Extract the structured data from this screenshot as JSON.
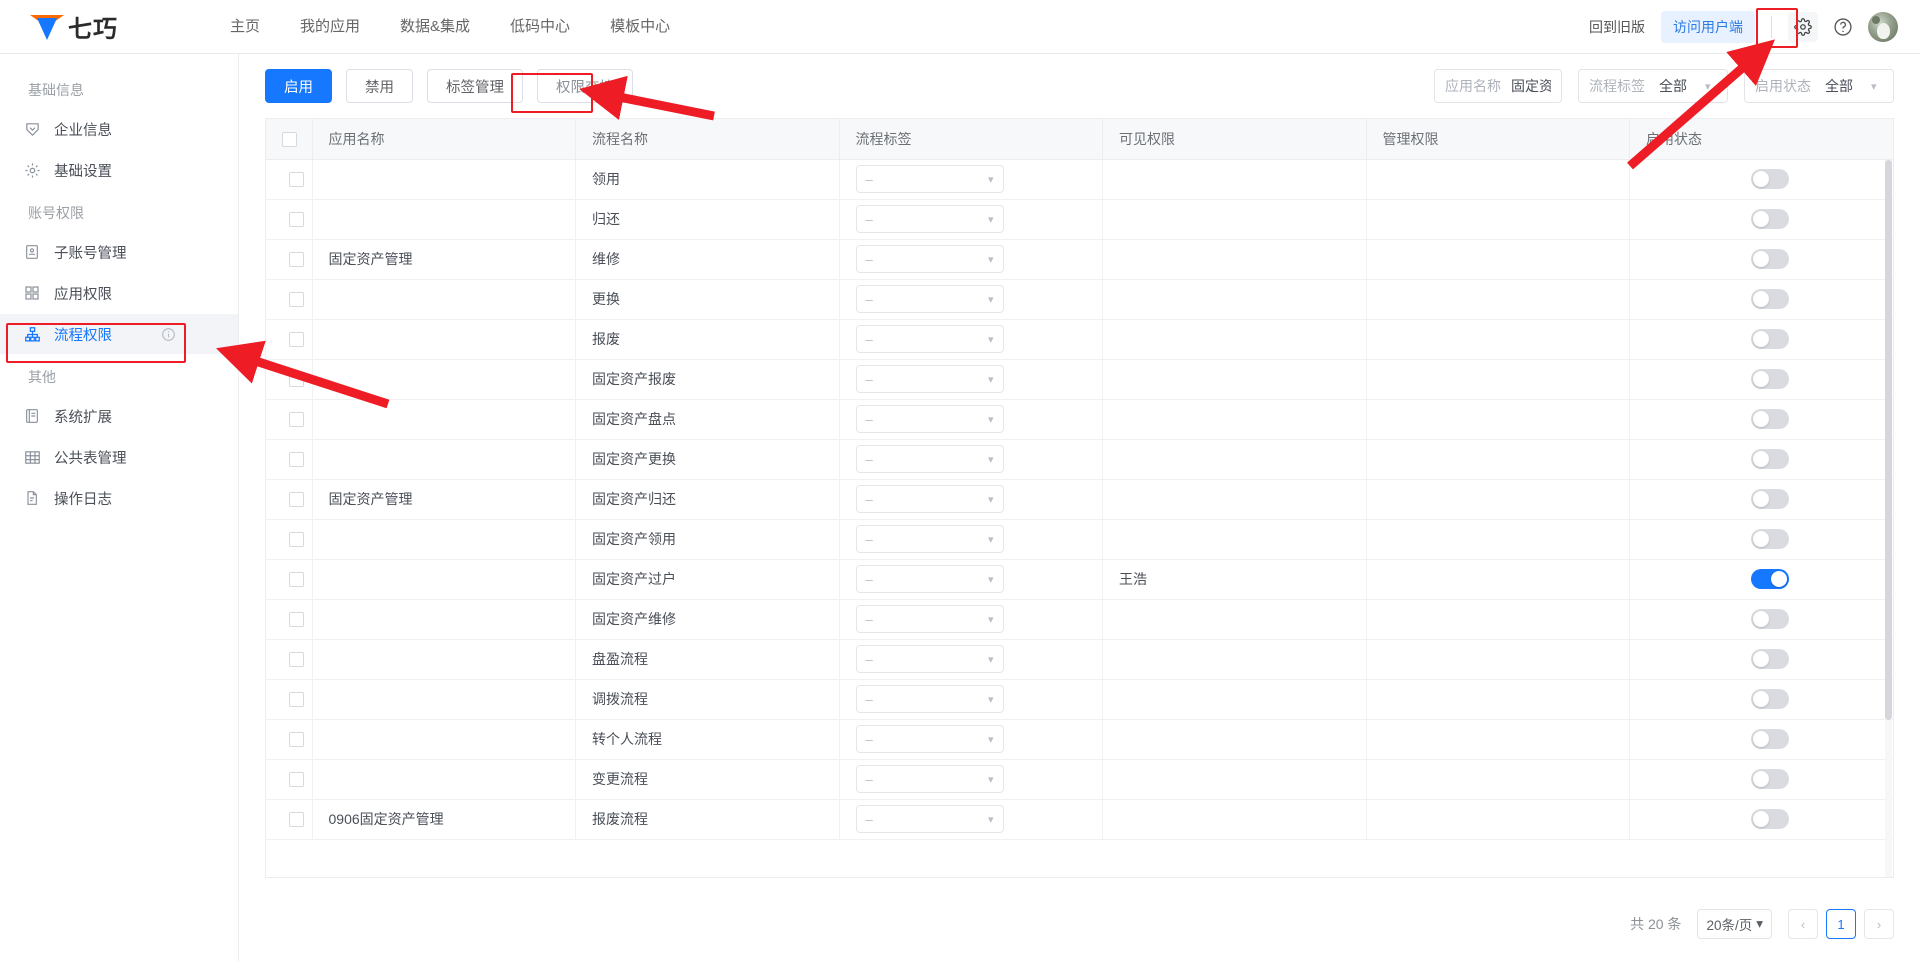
{
  "brand": {
    "name": "七巧",
    "logo_icon": "qiqiao-logo-icon"
  },
  "topnav": {
    "items": [
      {
        "label": "主页"
      },
      {
        "label": "我的应用"
      },
      {
        "label": "数据&集成"
      },
      {
        "label": "低码中心"
      },
      {
        "label": "模板中心"
      }
    ],
    "old_version_label": "回到旧版",
    "client_label": "访问用户端",
    "settings_icon": "gear-icon",
    "help_icon": "question-circle-icon",
    "avatar_icon": "user-avatar"
  },
  "sidebar": {
    "groups": [
      {
        "title": "基础信息",
        "items": [
          {
            "label": "企业信息",
            "icon": "shield-icon",
            "active": false
          },
          {
            "label": "基础设置",
            "icon": "gear-icon",
            "active": false
          }
        ]
      },
      {
        "title": "账号权限",
        "items": [
          {
            "label": "子账号管理",
            "icon": "id-card-icon",
            "active": false
          },
          {
            "label": "应用权限",
            "icon": "grid-apps-icon",
            "active": false
          },
          {
            "label": "流程权限",
            "icon": "sitemap-icon",
            "active": true,
            "info_icon": "info-circle-icon"
          }
        ]
      },
      {
        "title": "其他",
        "items": [
          {
            "label": "系统扩展",
            "icon": "book-icon",
            "active": false
          },
          {
            "label": "公共表管理",
            "icon": "table-icon",
            "active": false
          },
          {
            "label": "操作日志",
            "icon": "file-icon",
            "active": false
          }
        ]
      }
    ]
  },
  "toolbar": {
    "buttons": [
      {
        "label": "启用",
        "style": "primary"
      },
      {
        "label": "禁用",
        "style": "default"
      },
      {
        "label": "标签管理",
        "style": "default"
      },
      {
        "label": "权限交接",
        "style": "muted"
      }
    ],
    "filters": [
      {
        "label": "应用名称",
        "value": "固定资产管",
        "caret": false
      },
      {
        "label": "流程标签",
        "value": "全部",
        "caret": true
      },
      {
        "label": "启用状态",
        "value": "全部",
        "caret": true
      }
    ]
  },
  "table": {
    "columns": [
      "",
      "应用名称",
      "流程名称",
      "流程标签",
      "可见权限",
      "管理权限",
      "启用状态"
    ],
    "select_placeholder": "–",
    "rows": [
      {
        "app": "",
        "app_show": false,
        "flow": "领用",
        "tag": "–",
        "visible": "",
        "manage": "",
        "enabled": false
      },
      {
        "app": "",
        "app_show": false,
        "flow": "归还",
        "tag": "–",
        "visible": "",
        "manage": "",
        "enabled": false
      },
      {
        "app": "固定资产管理",
        "app_show": true,
        "flow": "维修",
        "tag": "–",
        "visible": "",
        "manage": "",
        "enabled": false
      },
      {
        "app": "",
        "app_show": false,
        "flow": "更换",
        "tag": "–",
        "visible": "",
        "manage": "",
        "enabled": false
      },
      {
        "app": "",
        "app_show": false,
        "flow": "报废",
        "tag": "–",
        "visible": "",
        "manage": "",
        "enabled": false,
        "group_end": true
      },
      {
        "app": "",
        "app_show": false,
        "flow": "固定资产报废",
        "tag": "–",
        "visible": "",
        "manage": "",
        "enabled": false
      },
      {
        "app": "",
        "app_show": false,
        "flow": "固定资产盘点",
        "tag": "–",
        "visible": "",
        "manage": "",
        "enabled": false
      },
      {
        "app": "",
        "app_show": false,
        "flow": "固定资产更换",
        "tag": "–",
        "visible": "",
        "manage": "",
        "enabled": false
      },
      {
        "app": "固定资产管理",
        "app_show": true,
        "flow": "固定资产归还",
        "tag": "–",
        "visible": "",
        "manage": "",
        "enabled": false
      },
      {
        "app": "",
        "app_show": false,
        "flow": "固定资产领用",
        "tag": "–",
        "visible": "",
        "manage": "",
        "enabled": false
      },
      {
        "app": "",
        "app_show": false,
        "flow": "固定资产过户",
        "tag": "–",
        "visible": "王浩",
        "manage": "",
        "enabled": true
      },
      {
        "app": "",
        "app_show": false,
        "flow": "固定资产维修",
        "tag": "–",
        "visible": "",
        "manage": "",
        "enabled": false,
        "group_end": true
      },
      {
        "app": "",
        "app_show": false,
        "flow": "盘盈流程",
        "tag": "–",
        "visible": "",
        "manage": "",
        "enabled": false
      },
      {
        "app": "",
        "app_show": false,
        "flow": "调拨流程",
        "tag": "–",
        "visible": "",
        "manage": "",
        "enabled": false
      },
      {
        "app": "",
        "app_show": false,
        "flow": "转个人流程",
        "tag": "–",
        "visible": "",
        "manage": "",
        "enabled": false
      },
      {
        "app": "",
        "app_show": false,
        "flow": "变更流程",
        "tag": "–",
        "visible": "",
        "manage": "",
        "enabled": false
      },
      {
        "app": "0906固定资产管理",
        "app_show": true,
        "flow": "报废流程",
        "tag": "–",
        "visible": "",
        "manage": "",
        "enabled": false
      }
    ]
  },
  "pagination": {
    "total_label": "共 20 条",
    "page_size_label": "20条/页",
    "prev_icon": "chevron-left-icon",
    "next_icon": "chevron-right-icon",
    "current_page": "1"
  },
  "annotations": {
    "accent_color": "#ee1c25",
    "highlights": [
      "流程权限",
      "权限交接",
      "gear-icon"
    ]
  }
}
